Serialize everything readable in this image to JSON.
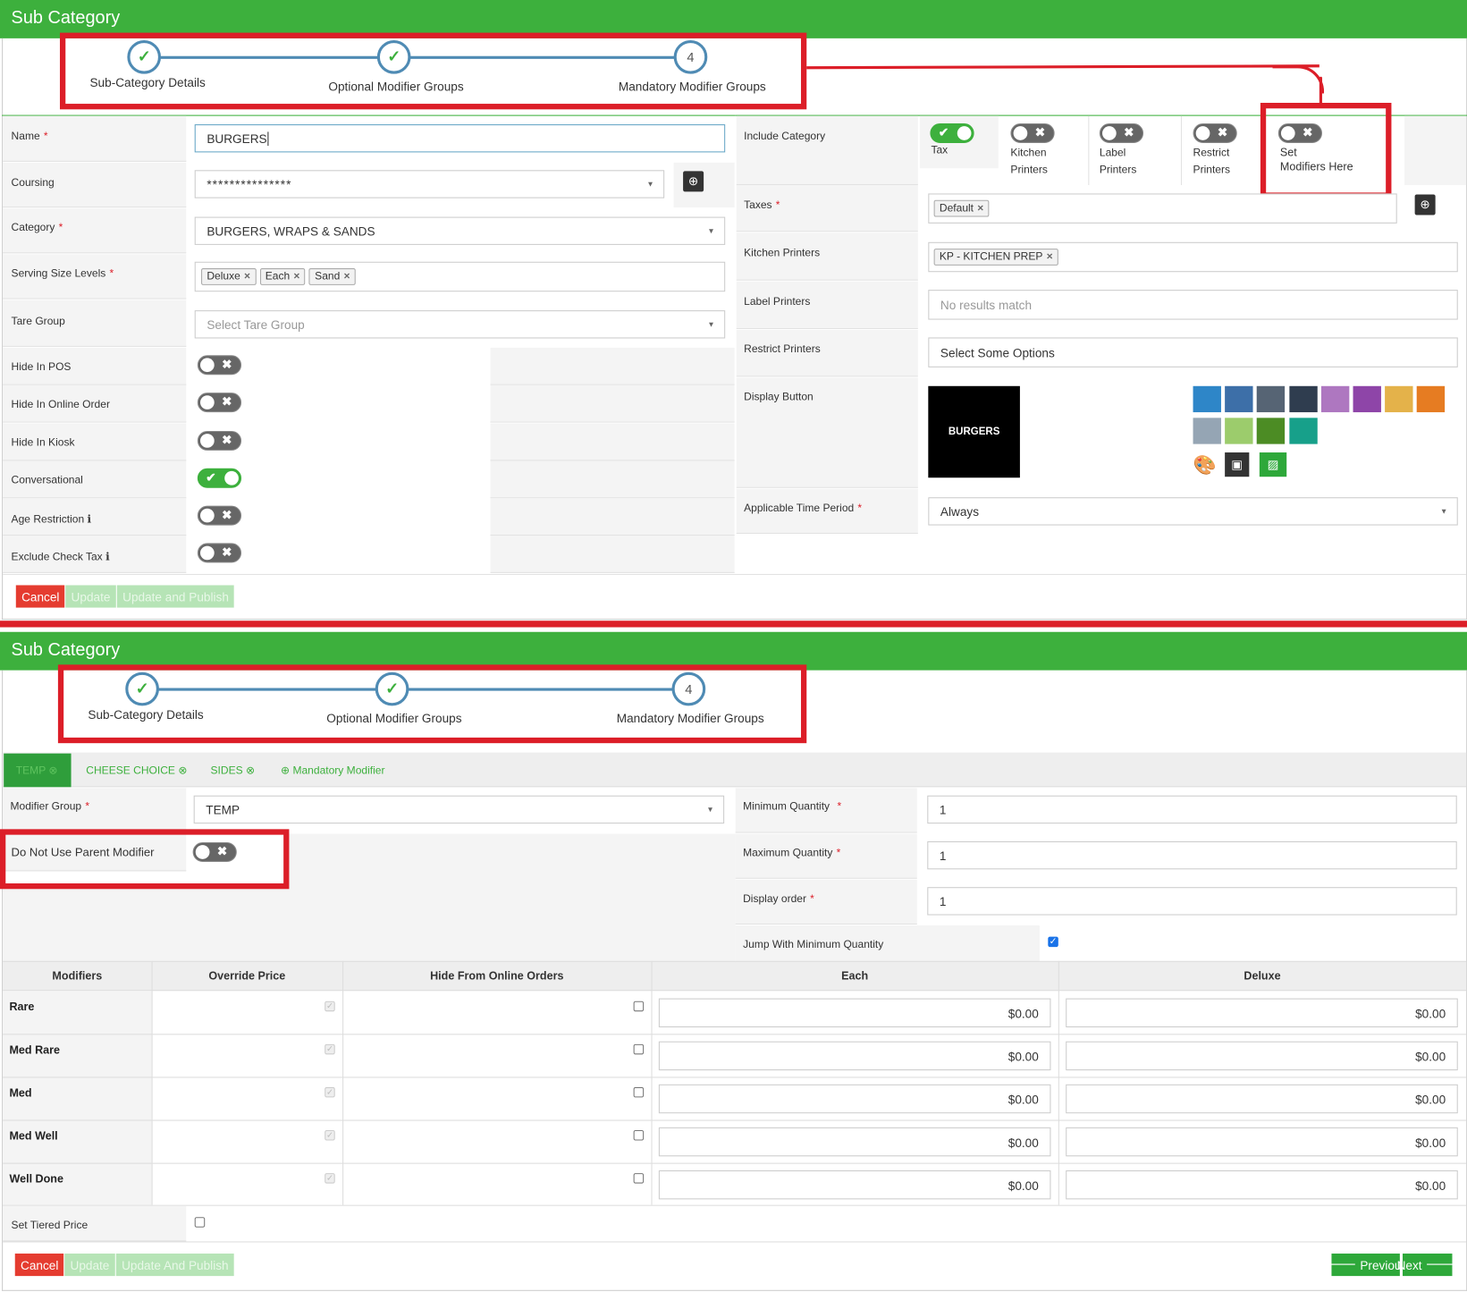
{
  "top": {
    "title": "Sub Category",
    "steps": [
      {
        "label": "Sub-Category Details",
        "state": "done"
      },
      {
        "label": "Optional Modifier Groups",
        "state": "done"
      },
      {
        "label": "Mandatory Modifier Groups",
        "state": "current",
        "num": "4"
      }
    ],
    "fields": {
      "name": {
        "label": "Name",
        "value": "BURGERS"
      },
      "coursing": {
        "label": "Coursing",
        "value": "***************"
      },
      "category": {
        "label": "Category",
        "value": "BURGERS, WRAPS & SANDS"
      },
      "serving": {
        "label": "Serving Size Levels",
        "tags": [
          "Deluxe",
          "Each",
          "Sand"
        ]
      },
      "tare": {
        "label": "Tare Group",
        "placeholder": "Select Tare Group"
      }
    },
    "toggles": [
      {
        "label": "Hide In POS",
        "on": false
      },
      {
        "label": "Hide In Online Order",
        "on": false
      },
      {
        "label": "Hide In Kiosk",
        "on": false
      },
      {
        "label": "Conversational",
        "on": true
      },
      {
        "label": "Age Restriction",
        "on": false
      },
      {
        "label": "Exclude Check Tax",
        "on": false
      }
    ],
    "right": {
      "include_label": "Include Category",
      "include": [
        {
          "l1": "Tax",
          "l2": "",
          "on": true
        },
        {
          "l1": "Kitchen",
          "l2": "Printers",
          "on": false
        },
        {
          "l1": "Label",
          "l2": "Printers",
          "on": false
        },
        {
          "l1": "Restrict",
          "l2": "Printers",
          "on": false
        },
        {
          "l1": "Set",
          "l2": "Modifiers Here",
          "on": false
        }
      ],
      "taxes": {
        "label": "Taxes",
        "tag": "Default"
      },
      "kitchen": {
        "label": "Kitchen Printers",
        "tag": "KP - KITCHEN PREP"
      },
      "labelp": {
        "label": "Label Printers",
        "placeholder": "No results match"
      },
      "restrict": {
        "label": "Restrict Printers",
        "placeholder": "Select Some Options"
      },
      "display": {
        "label": "Display Button",
        "preview": "BURGERS"
      },
      "time": {
        "label": "Applicable Time Period",
        "value": "Always"
      }
    },
    "buttons": {
      "cancel": "Cancel",
      "update": "Update",
      "publish": "Update and Publish"
    }
  },
  "bottom": {
    "title": "Sub Category",
    "tabs": [
      "TEMP",
      "CHEESE CHOICE",
      "SIDES",
      "Mandatory Modifier"
    ],
    "modgroup": {
      "label": "Modifier Group",
      "value": "TEMP"
    },
    "noparent": {
      "label": "Do Not Use Parent Modifier"
    },
    "minq": {
      "label": "Minimum Quantity",
      "value": "1"
    },
    "maxq": {
      "label": "Maximum Quantity",
      "value": "1"
    },
    "order": {
      "label": "Display order",
      "value": "1"
    },
    "jump": {
      "label": "Jump With Minimum Quantity"
    },
    "table": {
      "headers": [
        "Modifiers",
        "Override Price",
        "Hide From Online Orders",
        "Each",
        "Deluxe"
      ],
      "rows": [
        {
          "name": "Rare",
          "each": "$0.00",
          "deluxe": "$0.00"
        },
        {
          "name": "Med Rare",
          "each": "$0.00",
          "deluxe": "$0.00"
        },
        {
          "name": "Med",
          "each": "$0.00",
          "deluxe": "$0.00"
        },
        {
          "name": "Med Well",
          "each": "$0.00",
          "deluxe": "$0.00"
        },
        {
          "name": "Well Done",
          "each": "$0.00",
          "deluxe": "$0.00"
        }
      ]
    },
    "tiered": {
      "label": "Set Tiered Price"
    },
    "buttons": {
      "cancel": "Cancel",
      "update": "Update",
      "publish": "Update And Publish",
      "previous": "Previous",
      "next": "Next"
    }
  },
  "colors": {
    "brand": "#3db03d",
    "highlight": "#dc1e28",
    "swatches": [
      "#2e86c8",
      "#3d6fa8",
      "#566474",
      "#2f3d4f",
      "#ae77c0",
      "#8e45a8",
      "#e4b24a",
      "#e67c22",
      "#95a5b4",
      "#9ccc6c",
      "#4c8c24",
      "#17a08a"
    ]
  }
}
